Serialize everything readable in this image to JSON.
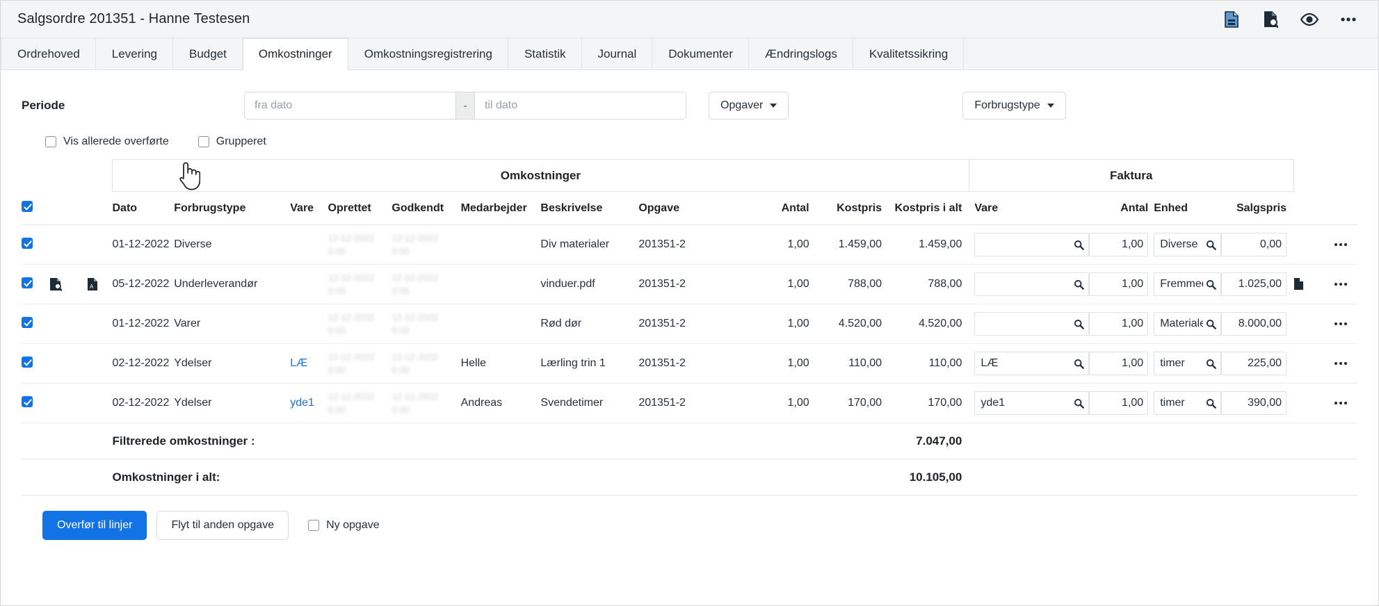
{
  "window": {
    "title": "Salgsordre 201351 - Hanne Testesen",
    "icons": [
      {
        "name": "document-save-icon",
        "glyph": "doc-save"
      },
      {
        "name": "document-search-icon",
        "glyph": "doc-search"
      },
      {
        "name": "eye-icon",
        "glyph": "eye"
      },
      {
        "name": "more-options-icon",
        "glyph": "ellipsis"
      }
    ]
  },
  "tabs": [
    {
      "label": "Ordrehoved",
      "active": false
    },
    {
      "label": "Levering",
      "active": false
    },
    {
      "label": "Budget",
      "active": false
    },
    {
      "label": "Omkostninger",
      "active": true
    },
    {
      "label": "Omkostningsregistrering",
      "active": false
    },
    {
      "label": "Statistik",
      "active": false
    },
    {
      "label": "Journal",
      "active": false
    },
    {
      "label": "Dokumenter",
      "active": false
    },
    {
      "label": "Ændringslogs",
      "active": false
    },
    {
      "label": "Kvalitetssikring",
      "active": false
    }
  ],
  "filters": {
    "period_label": "Periode",
    "date_from_value": "",
    "date_from_placeholder": "fra dato",
    "date_separator": "-",
    "date_to_value": "",
    "date_to_placeholder": "til dato",
    "opgaver_button": "Opgaver",
    "forbrugstype_button": "Forbrugstype",
    "show_transferred_label": "Vis allerede overførte",
    "show_transferred_checked": false,
    "grouped_label": "Grupperet",
    "grouped_checked": false
  },
  "table": {
    "group_headers": {
      "omkostninger": "Omkostninger",
      "faktura": "Faktura"
    },
    "select_all_checked": true,
    "columns_cost": [
      "Dato",
      "Forbrugstype",
      "Vare",
      "Oprettet",
      "Godkendt",
      "Medarbejder",
      "Beskrivelse",
      "Opgave",
      "Antal",
      "Kostpris",
      "Kostpris i alt"
    ],
    "columns_invoice": [
      "Vare",
      "Antal",
      "Enhed",
      "Salgspris"
    ],
    "rows": [
      {
        "selected": true,
        "has_search_icon": false,
        "has_pdf_icon": false,
        "dato": "01-12-2022",
        "forbrugstype": "Diverse",
        "vare": "",
        "oprettet": "",
        "godkendt": "",
        "medarbejder": "",
        "beskrivelse": "Div materialer",
        "opgave": "201351-2",
        "antal": "1,00",
        "kostpris": "1.459,00",
        "kostpris_i_alt": "1.459,00",
        "faktura_vare": "",
        "faktura_antal": "1,00",
        "faktura_enhed": "Diverse",
        "faktura_salgspris": "0,00",
        "has_attachment": false
      },
      {
        "selected": true,
        "has_search_icon": true,
        "has_pdf_icon": true,
        "dato": "05-12-2022",
        "forbrugstype": "Underleverandør",
        "vare": "",
        "oprettet": "",
        "godkendt": "",
        "medarbejder": "",
        "beskrivelse": "vinduer.pdf",
        "opgave": "201351-2",
        "antal": "1,00",
        "kostpris": "788,00",
        "kostpris_i_alt": "788,00",
        "faktura_vare": "",
        "faktura_antal": "1,00",
        "faktura_enhed": "Fremmed",
        "faktura_salgspris": "1.025,00",
        "has_attachment": true
      },
      {
        "selected": true,
        "has_search_icon": false,
        "has_pdf_icon": false,
        "dato": "01-12-2022",
        "forbrugstype": "Varer",
        "vare": "",
        "oprettet": "",
        "godkendt": "",
        "medarbejder": "",
        "beskrivelse": "Rød dør",
        "opgave": "201351-2",
        "antal": "1,00",
        "kostpris": "4.520,00",
        "kostpris_i_alt": "4.520,00",
        "faktura_vare": "",
        "faktura_antal": "1,00",
        "faktura_enhed": "Materiale",
        "faktura_salgspris": "8.000,00",
        "has_attachment": false
      },
      {
        "selected": true,
        "has_search_icon": false,
        "has_pdf_icon": false,
        "dato": "02-12-2022",
        "forbrugstype": "Ydelser",
        "vare": "LÆ",
        "oprettet": "",
        "godkendt": "",
        "medarbejder": "Helle",
        "beskrivelse": "Lærling trin 1",
        "opgave": "201351-2",
        "antal": "1,00",
        "kostpris": "110,00",
        "kostpris_i_alt": "110,00",
        "faktura_vare": "LÆ",
        "faktura_antal": "1,00",
        "faktura_enhed": "timer",
        "faktura_salgspris": "225,00",
        "has_attachment": false
      },
      {
        "selected": true,
        "has_search_icon": false,
        "has_pdf_icon": false,
        "dato": "02-12-2022",
        "forbrugstype": "Ydelser",
        "vare": "yde1",
        "oprettet": "",
        "godkendt": "",
        "medarbejder": "Andreas",
        "beskrivelse": "Svendetimer",
        "opgave": "201351-2",
        "antal": "1,00",
        "kostpris": "170,00",
        "kostpris_i_alt": "170,00",
        "faktura_vare": "yde1",
        "faktura_antal": "1,00",
        "faktura_enhed": "timer",
        "faktura_salgspris": "390,00",
        "has_attachment": false
      }
    ],
    "totals": [
      {
        "label": "Filtrerede omkostninger :",
        "value": "7.047,00"
      },
      {
        "label": "Omkostninger i alt:",
        "value": "10.105,00"
      }
    ]
  },
  "footer": {
    "transfer_button": "Overfør til linjer",
    "move_button": "Flyt til anden opgave",
    "new_task_label": "Ny opgave",
    "new_task_checked": false
  },
  "colors": {
    "accent": "#1273e6",
    "link": "#2070d8",
    "tabbar_bg": "#f4f5f6",
    "border": "#e1e2e4"
  }
}
